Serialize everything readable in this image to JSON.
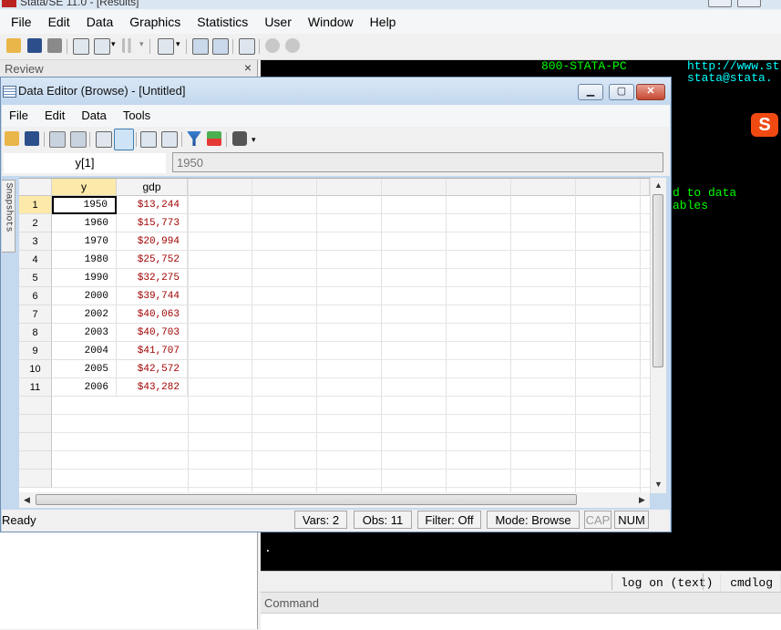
{
  "main": {
    "title": "Stata/SE 11.0 - [Results]",
    "menu": [
      "File",
      "Edit",
      "Data",
      "Graphics",
      "Statistics",
      "User",
      "Window",
      "Help"
    ]
  },
  "review": {
    "title": "Review",
    "close": "×"
  },
  "results": {
    "phone": "800-STATA-PC",
    "url": "http://www.st",
    "email": "stata@stata.",
    "line1": "d to data",
    "line2": "ables",
    "prompt": "."
  },
  "log_status": {
    "log": "log on (text)",
    "cmdlog": "cmdlog on"
  },
  "command": {
    "title": "Command"
  },
  "data_editor": {
    "title": "Data Editor (Browse) - [Untitled]",
    "menu": [
      "File",
      "Edit",
      "Data",
      "Tools"
    ],
    "cell_name": "y[1]",
    "cell_value": "1950",
    "snapshots_label": "Snapshots",
    "columns": [
      "y",
      "gdp"
    ],
    "rows": [
      {
        "n": "1",
        "y": "1950",
        "gdp": "$13,244"
      },
      {
        "n": "2",
        "y": "1960",
        "gdp": "$15,773"
      },
      {
        "n": "3",
        "y": "1970",
        "gdp": "$20,994"
      },
      {
        "n": "4",
        "y": "1980",
        "gdp": "$25,752"
      },
      {
        "n": "5",
        "y": "1990",
        "gdp": "$32,275"
      },
      {
        "n": "6",
        "y": "2000",
        "gdp": "$39,744"
      },
      {
        "n": "7",
        "y": "2002",
        "gdp": "$40,063"
      },
      {
        "n": "8",
        "y": "2003",
        "gdp": "$40,703"
      },
      {
        "n": "9",
        "y": "2004",
        "gdp": "$41,707"
      },
      {
        "n": "10",
        "y": "2005",
        "gdp": "$42,572"
      },
      {
        "n": "11",
        "y": "2006",
        "gdp": "$43,282"
      }
    ],
    "status": {
      "ready": "Ready",
      "vars": "Vars: 2",
      "obs": "Obs: 11",
      "filter": "Filter: Off",
      "mode": "Mode: Browse",
      "cap": "CAP",
      "num": "NUM"
    }
  },
  "colors": {
    "results_bg": "#000000",
    "results_text_cyan": "#00ffff",
    "results_text_green": "#00ff00",
    "gdp_text": "#a00000",
    "selected_header": "#fde9a9"
  },
  "icons": [
    "open-icon",
    "save-icon",
    "print-icon",
    "log-icon",
    "viewer-icon",
    "graph-icon",
    "do-editor-icon",
    "data-editor-icon",
    "data-browser-icon",
    "variables-manager-icon",
    "break-icon",
    "clear-icon",
    "filter-icon",
    "sort-icon",
    "snapshot-icon",
    "sogou-ime-icon"
  ]
}
